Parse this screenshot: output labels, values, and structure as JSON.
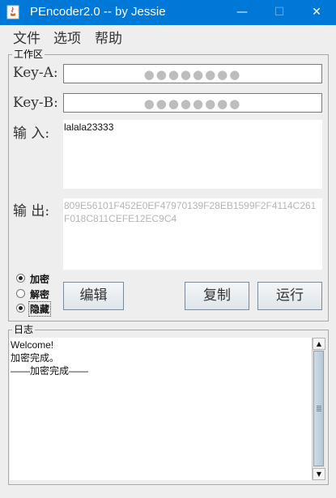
{
  "window": {
    "title": "PEncoder2.0 -- by Jessie",
    "controls": {
      "minimize": "—",
      "maximize": "☐",
      "close": "✕"
    }
  },
  "menu": {
    "items": [
      "文件",
      "选项",
      "帮助"
    ]
  },
  "workspace": {
    "title": "工作区",
    "key_a_label": "Key-A:",
    "key_a_mask": "●●●●●●●●",
    "key_b_label": "Key-B:",
    "key_b_mask": "●●●●●●●●",
    "input_label": "输 入:",
    "input_value": "lalala23333",
    "output_label": "输 出:",
    "output_value": "809E56101F452E0EF47970139F28EB1599F2F4114C261F018C811CEFE12EC9C4"
  },
  "mode": {
    "options": [
      "加密",
      "解密",
      "隐藏"
    ],
    "selected": [
      "加密",
      "隐藏"
    ]
  },
  "buttons": {
    "edit": "编辑",
    "copy": "复制",
    "run": "运行"
  },
  "log": {
    "title": "日志",
    "lines": [
      "Welcome!",
      "加密完成。",
      "——加密完成——"
    ]
  },
  "scrollbar": {
    "up_arrow": "▲",
    "down_arrow": "▼"
  }
}
